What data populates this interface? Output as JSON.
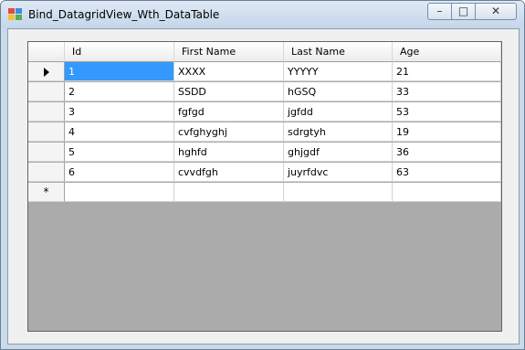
{
  "window": {
    "title": "Bind_DatagridView_Wth_DataTable",
    "minimize_glyph": "–",
    "maximize_glyph": "□",
    "close_glyph": "✕",
    "icon": "winforms-app-icon"
  },
  "grid": {
    "columns": [
      "Id",
      "First Name",
      "Last Name",
      "Age"
    ],
    "rows": [
      [
        "1",
        "XXXX",
        "YYYYY",
        "21"
      ],
      [
        "2",
        "SSDD",
        "hGSQ",
        "33"
      ],
      [
        "3",
        "fgfgd",
        "jgfdd",
        "53"
      ],
      [
        "4",
        "cvfghyghj",
        "sdrgtyh",
        "19"
      ],
      [
        "5",
        "hghfd",
        "ghjgdf",
        "36"
      ],
      [
        "6",
        "cvvdfgh",
        "juyrfdvc",
        "63"
      ]
    ],
    "new_row_glyph": "*",
    "current_row_icon": "current-row-arrow-icon",
    "selected_cell": "Id of row 1",
    "colors": {
      "selection": "#3399ff",
      "background": "#ababab"
    }
  }
}
